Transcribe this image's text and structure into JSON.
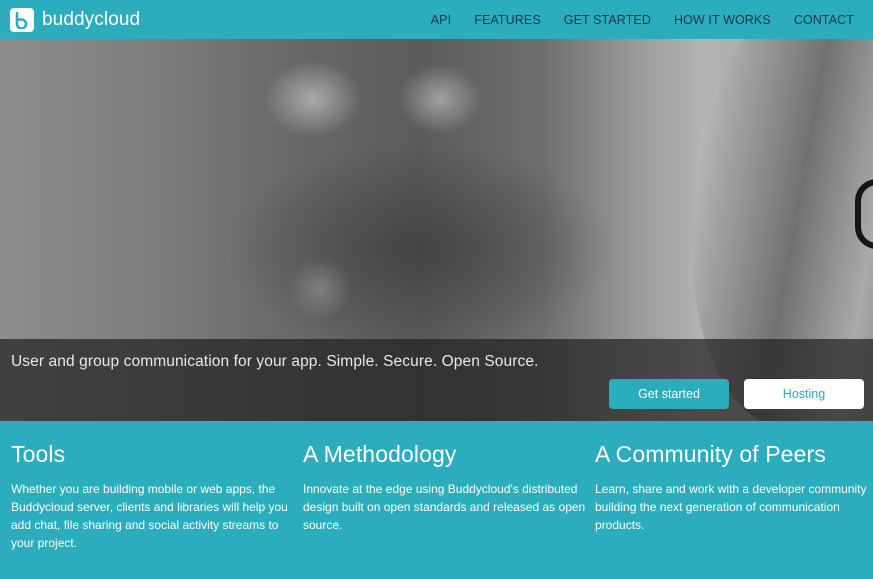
{
  "brand": {
    "name": "buddycloud",
    "logo_icon": "buddycloud-logo-icon"
  },
  "nav": {
    "items": [
      {
        "label": "API"
      },
      {
        "label": "FEATURES"
      },
      {
        "label": "GET STARTED"
      },
      {
        "label": "HOW IT WORKS"
      },
      {
        "label": "CONTACT"
      }
    ]
  },
  "hero": {
    "tagline": "User and group communication for your app. Simple. Secure. Open Source.",
    "primary_button": "Get started",
    "secondary_button": "Hosting"
  },
  "features": [
    {
      "title": "Tools",
      "text": "Whether you are building mobile or web apps, the Buddycloud server, clients and libraries will help you add chat, file sharing and social activity streams to your project."
    },
    {
      "title": "A Methodology",
      "text": "Innovate at the edge using Buddycloud's distributed design built on open standards and released as open source."
    },
    {
      "title": "A Community of Peers",
      "text": "Learn, share and work with a developer community building the next generation of communication products."
    }
  ],
  "colors": {
    "accent": "#2cadbd",
    "nav_text": "#123a45",
    "overlay": "#232323"
  }
}
